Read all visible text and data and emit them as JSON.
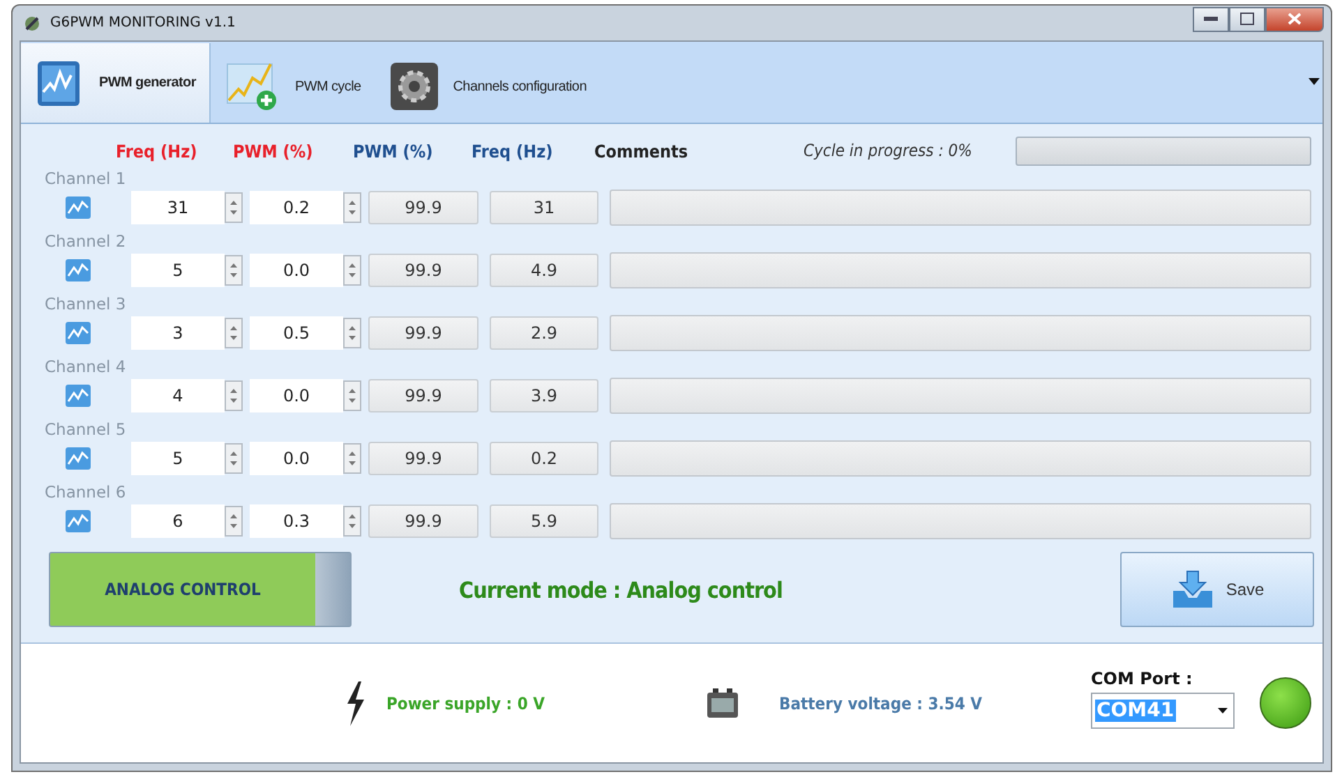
{
  "window": {
    "title": "G6PWM MONITORING v1.1"
  },
  "tabs": [
    {
      "label": "PWM generator",
      "selected": true,
      "kind": "chart"
    },
    {
      "label": "PWM cycle",
      "selected": false,
      "kind": "cycle"
    },
    {
      "label": "Channels configuration",
      "selected": false,
      "kind": "gear"
    }
  ],
  "columns": [
    {
      "label": "Freq (Hz)",
      "color": "#e8202a"
    },
    {
      "label": "PWM (%)",
      "color": "#e8202a"
    },
    {
      "label": "PWM (%)",
      "color": "#1f4f8f"
    },
    {
      "label": "Freq (Hz)",
      "color": "#1f4f8f"
    },
    {
      "label": "Comments",
      "color": "#222222"
    }
  ],
  "cycle": {
    "label": "Cycle in progress : 0%",
    "level": 0
  },
  "channels": [
    {
      "name": "Channel 1",
      "freq": "31",
      "pwm": "0.2",
      "pwm_out": "99.9",
      "freq_out": "31"
    },
    {
      "name": "Channel 2",
      "freq": "5",
      "pwm": "0.0",
      "pwm_out": "99.9",
      "freq_out": "4.9"
    },
    {
      "name": "Channel 3",
      "freq": "3",
      "pwm": "0.5",
      "pwm_out": "99.9",
      "freq_out": "2.9"
    },
    {
      "name": "Channel 4",
      "freq": "4",
      "pwm": "0.0",
      "pwm_out": "99.9",
      "freq_out": "3.9"
    },
    {
      "name": "Channel 5",
      "freq": "5",
      "pwm": "0.0",
      "pwm_out": "99.9",
      "freq_out": "0.2"
    },
    {
      "name": "Channel 6",
      "freq": "6",
      "pwm": "0.3",
      "pwm_out": "99.9",
      "freq_out": "5.9"
    }
  ],
  "mode_toggle": {
    "label": "ANALOG CONTROL",
    "on": true
  },
  "mode_status": "Current mode : Analog control",
  "save_button": "Save",
  "power_supply": "Power supply : 0 V",
  "battery": "Battery voltage : 3.54 V",
  "com_port": {
    "label": "COM Port :",
    "value": "COM41",
    "connected": true
  }
}
